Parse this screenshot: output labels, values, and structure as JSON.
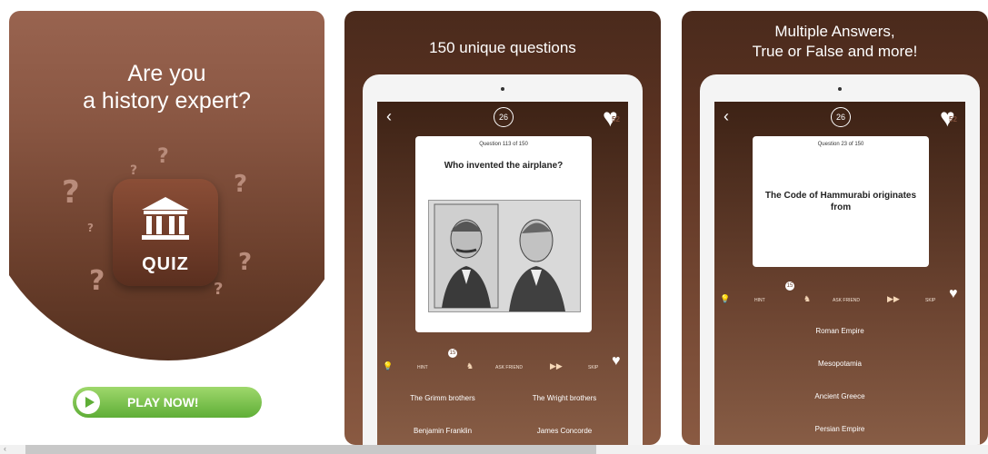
{
  "card1": {
    "headline_line1": "Are you",
    "headline_line2": "a history expert?",
    "app_icon_label": "QUIZ",
    "play_button_label": "PLAY NOW!"
  },
  "card2": {
    "caption": "150 unique questions",
    "timer": "26",
    "lives": "52",
    "question_number": "Question 113 of 150",
    "question": "Who invented the airplane?",
    "hint_badge": "15",
    "toolbar": {
      "hint": "HINT",
      "ask_friend": "ASK FRIEND",
      "skip": "SKIP"
    },
    "answers": [
      "The Grimm brothers",
      "The Wright brothers",
      "Benjamin Franklin",
      "James Concorde"
    ]
  },
  "card3": {
    "caption_line1": "Multiple Answers,",
    "caption_line2": "True or False and more!",
    "timer": "26",
    "lives": "52",
    "question_number": "Question 23 of 150",
    "question_line1": "The Code of Hammurabi originates",
    "question_line2": "from",
    "hint_badge": "15",
    "toolbar": {
      "hint": "HINT",
      "ask_friend": "ASK FRIEND",
      "skip": "SKIP"
    },
    "answers": [
      "Roman Empire",
      "Mesopotamia",
      "Ancient Greece",
      "Persian Empire"
    ]
  },
  "colors": {
    "brown_dark": "#4a2a1c",
    "brown_light": "#8a5a42",
    "play_green": "#6fbf44"
  },
  "icons": [
    "temple-icon",
    "question-mark-icon",
    "play-icon",
    "back-icon",
    "heart-icon",
    "lightbulb-icon",
    "ask-friend-icon",
    "skip-icon"
  ]
}
